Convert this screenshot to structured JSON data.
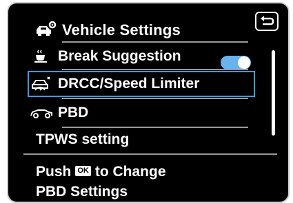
{
  "header": {
    "title": "Vehicle Settings",
    "icon": "car-gear-icon"
  },
  "back_button": {
    "icon": "back-arrow-icon"
  },
  "menu": {
    "items": [
      {
        "label": "Break Suggestion",
        "icon": "coffee-cup-icon",
        "toggle_on": true
      },
      {
        "label": "DRCC/Speed Limiter",
        "icon": "car-speed-icon",
        "selected": true
      },
      {
        "label": "PBD",
        "icon": "car-side-icon"
      },
      {
        "label": "TPWS setting"
      }
    ]
  },
  "hint": {
    "line1_prefix": "Push",
    "ok_label": "OK",
    "line1_suffix": "to Change",
    "line2": "PBD Settings"
  },
  "colors": {
    "selection_border": "#3d9be0",
    "toggle_on": "#6ab1ef"
  }
}
